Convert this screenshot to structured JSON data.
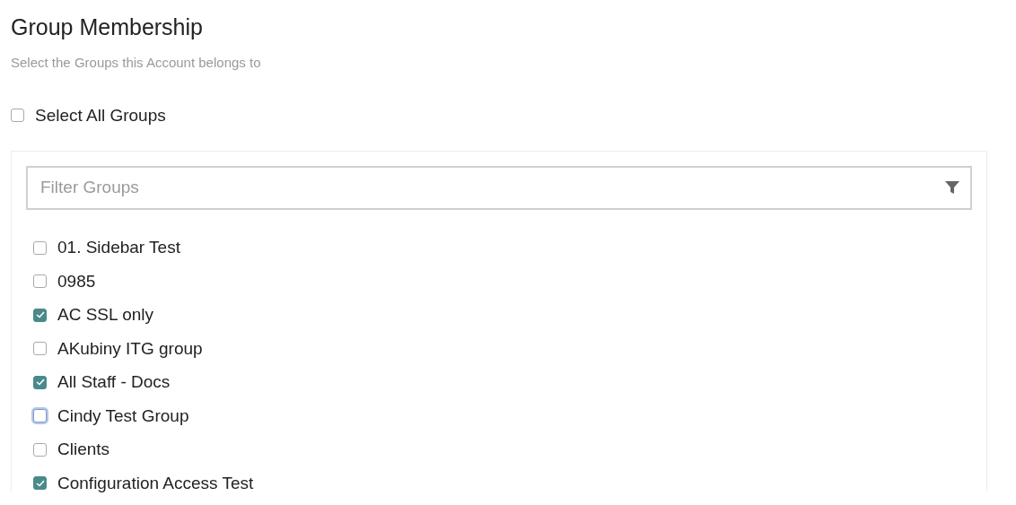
{
  "title": "Group Membership",
  "subtitle": "Select the Groups this Account belongs to",
  "select_all": {
    "label": "Select All Groups",
    "checked": false
  },
  "filter": {
    "placeholder": "Filter Groups"
  },
  "groups": [
    {
      "label": "01. Sidebar Test",
      "checked": false,
      "focused": false
    },
    {
      "label": "0985",
      "checked": false,
      "focused": false
    },
    {
      "label": "AC SSL only",
      "checked": true,
      "focused": false
    },
    {
      "label": "AKubiny ITG group",
      "checked": false,
      "focused": false
    },
    {
      "label": "All Staff - Docs",
      "checked": true,
      "focused": false
    },
    {
      "label": "Cindy Test Group",
      "checked": false,
      "focused": true
    },
    {
      "label": "Clients",
      "checked": false,
      "focused": false
    },
    {
      "label": "Configuration Access Test",
      "checked": true,
      "focused": false
    }
  ]
}
